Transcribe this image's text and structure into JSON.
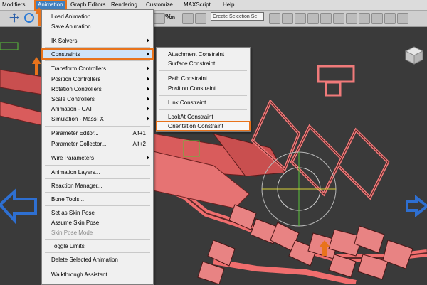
{
  "colors": {
    "accent_highlight": "#e8731c",
    "menu_active": "#3f7fbf",
    "menu_background": "#f0f0f0",
    "viewport_background": "#3a3a3a",
    "model_fill": "#e87a7a",
    "model_wire": "#f26e6e",
    "helper_blue": "#2e6fd1",
    "helper_green": "#59c43a"
  },
  "menubar": {
    "items": [
      "Modifiers",
      "Animation",
      "Graph Editors",
      "Rendering",
      "Customize",
      "MAXScript",
      "Help"
    ],
    "active": "Animation"
  },
  "toolbar": {
    "selection_set_placeholder": "Create Selection Se",
    "percent_label": "%",
    "n_label": "n"
  },
  "animation_menu": {
    "items": [
      {
        "label": "Load Animation...",
        "shortcut": "",
        "submenu": false,
        "disabled": false
      },
      {
        "label": "Save Animation...",
        "shortcut": "",
        "submenu": false,
        "disabled": false
      },
      {
        "label": "IK Solvers",
        "shortcut": "",
        "submenu": true,
        "disabled": false
      },
      {
        "label": "Constraints",
        "shortcut": "",
        "submenu": true,
        "disabled": false,
        "highlighted": true
      },
      {
        "label": "Transform Controllers",
        "shortcut": "",
        "submenu": true,
        "disabled": false
      },
      {
        "label": "Position Controllers",
        "shortcut": "",
        "submenu": true,
        "disabled": false
      },
      {
        "label": "Rotation Controllers",
        "shortcut": "",
        "submenu": true,
        "disabled": false
      },
      {
        "label": "Scale Controllers",
        "shortcut": "",
        "submenu": true,
        "disabled": false
      },
      {
        "label": "Animation - CAT",
        "shortcut": "",
        "submenu": true,
        "disabled": false
      },
      {
        "label": "Simulation - MassFX",
        "shortcut": "",
        "submenu": true,
        "disabled": false
      },
      {
        "label": "Parameter Editor...",
        "shortcut": "Alt+1",
        "submenu": false,
        "disabled": false
      },
      {
        "label": "Parameter Collector...",
        "shortcut": "Alt+2",
        "submenu": false,
        "disabled": false
      },
      {
        "label": "Wire Parameters",
        "shortcut": "",
        "submenu": true,
        "disabled": false
      },
      {
        "label": "Animation Layers...",
        "shortcut": "",
        "submenu": false,
        "disabled": false
      },
      {
        "label": "Reaction Manager...",
        "shortcut": "",
        "submenu": false,
        "disabled": false
      },
      {
        "label": "Bone Tools...",
        "shortcut": "",
        "submenu": false,
        "disabled": false
      },
      {
        "label": "Set as Skin Pose",
        "shortcut": "",
        "submenu": false,
        "disabled": false
      },
      {
        "label": "Assume Skin Pose",
        "shortcut": "",
        "submenu": false,
        "disabled": false
      },
      {
        "label": "Skin Pose Mode",
        "shortcut": "",
        "submenu": false,
        "disabled": true
      },
      {
        "label": "Toggle Limits",
        "shortcut": "",
        "submenu": false,
        "disabled": false
      },
      {
        "label": "Delete Selected Animation",
        "shortcut": "",
        "submenu": false,
        "disabled": false
      },
      {
        "label": "Walkthrough Assistant...",
        "shortcut": "",
        "submenu": false,
        "disabled": false
      }
    ]
  },
  "constraints_submenu": {
    "items": [
      {
        "label": "Attachment Constraint",
        "highlighted": false
      },
      {
        "label": "Surface Constraint",
        "highlighted": false
      },
      {
        "label": "Path Constraint",
        "highlighted": false
      },
      {
        "label": "Position Constraint",
        "highlighted": false
      },
      {
        "label": "Link Constraint",
        "highlighted": false
      },
      {
        "label": "LookAt Constraint",
        "highlighted": false
      },
      {
        "label": "Orientation Constraint",
        "highlighted": true
      }
    ]
  }
}
